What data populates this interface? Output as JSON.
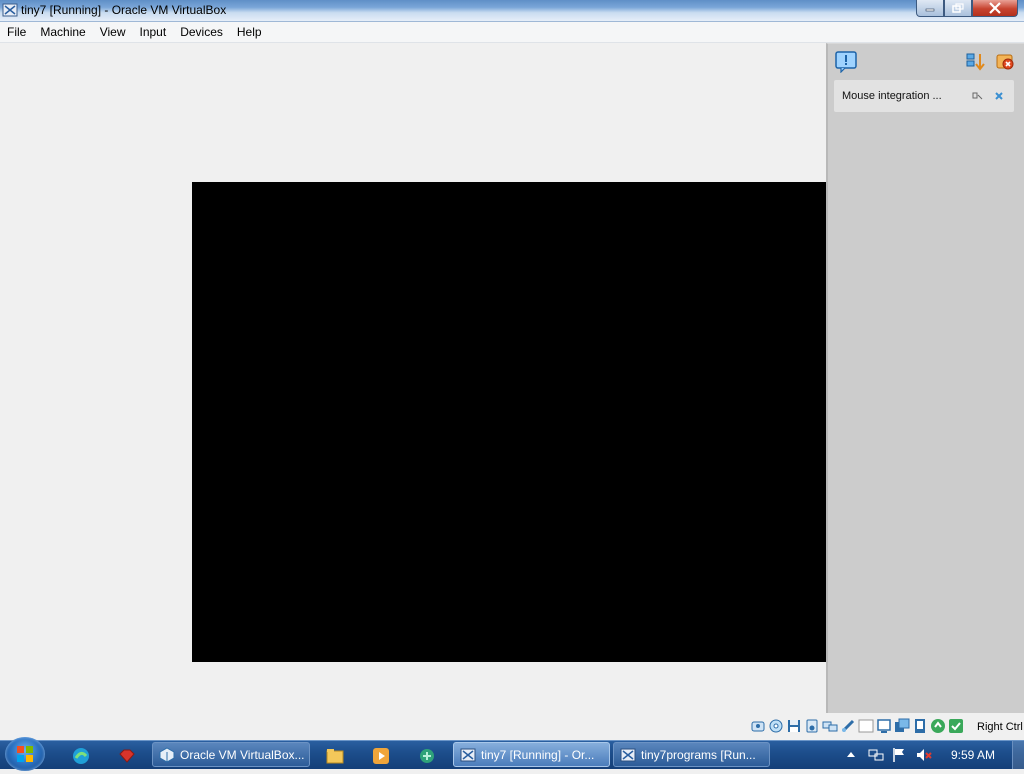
{
  "window": {
    "title": "tiny7 [Running] - Oracle VM VirtualBox",
    "minimize_icon": "minimize-icon",
    "maximize_icon": "restore-icon",
    "close_icon": "close-icon"
  },
  "menubar": {
    "items": [
      {
        "label": "File"
      },
      {
        "label": "Machine"
      },
      {
        "label": "View"
      },
      {
        "label": "Input"
      },
      {
        "label": "Devices"
      },
      {
        "label": "Help"
      }
    ]
  },
  "notification_panel": {
    "header_icon": "notification-icon",
    "actions": [
      "sort-icon",
      "close-all-icon"
    ],
    "message": {
      "text": "Mouse integration ...",
      "icons": [
        "mouse-integration-icon",
        "dismiss-icon"
      ]
    }
  },
  "statusbar": {
    "device_icons": [
      "hard-disk-icon",
      "optical-drive-icon",
      "floppy-icon",
      "audio-icon",
      "network-icon",
      "usb-icon",
      "shared-folders-icon",
      "display-icon",
      "recording-icon",
      "cpu-icon",
      "mouse-integration-icon",
      "keyboard-icon"
    ],
    "host_key": "Right Ctrl"
  },
  "taskbar": {
    "pinned": [
      "start-orb-icon",
      "edge-icon",
      "ruby-icon",
      "virtualbox-icon",
      "explorer-icon",
      "media-player-icon",
      "network-icon"
    ],
    "tasks": [
      {
        "label": "Oracle VM VirtualBox...",
        "icon": "virtualbox-icon",
        "active": false
      },
      {
        "label": "tiny7 [Running] - Or...",
        "icon": "virtualbox-vm-icon",
        "active": true
      },
      {
        "label": "tiny7programs [Run...",
        "icon": "virtualbox-vm-icon",
        "active": false
      }
    ],
    "tray_icons": [
      "show-hidden-icon",
      "network-tray-icon",
      "action-center-icon",
      "volume-muted-icon"
    ],
    "clock": "9:59 AM"
  },
  "colors": {
    "vm_screen": "#000000",
    "panel_bg": "#cccccc",
    "taskbar": "#1d4e8c"
  }
}
